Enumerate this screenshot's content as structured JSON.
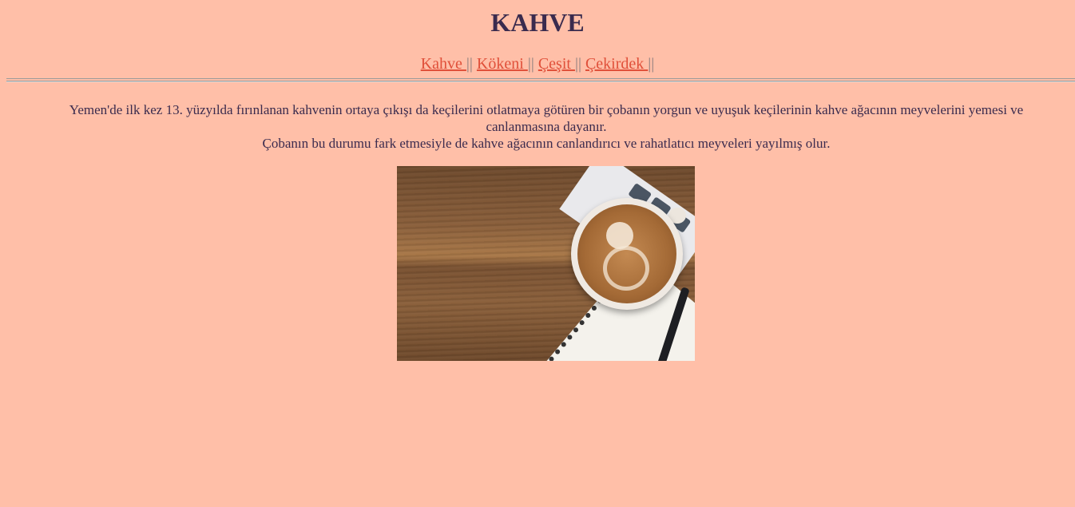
{
  "header": {
    "title": "KAHVE"
  },
  "nav": {
    "items": [
      {
        "label": "Kahve "
      },
      {
        "label": "Kökeni "
      },
      {
        "label": "Çeşit "
      },
      {
        "label": "Çekirdek "
      }
    ],
    "separator": "||"
  },
  "content": {
    "paragraph_line1": "Yemen'de ilk kez 13. yüzyılda fırınlanan kahvenin ortaya çıkışı da keçilerini otlatmaya götüren bir çobanın yorgun ve uyuşuk keçilerinin kahve ağacının meyvelerini yemesi ve canlanmasına dayanır.",
    "paragraph_line2": "Çobanın bu durumu fark etmesiyle de kahve ağacının canlandırıcı ve rahatlatıcı meyveleri yayılmış olur."
  },
  "colors": {
    "background": "#ffbfa8",
    "title": "#3a2b4e",
    "link": "#e0503a",
    "text": "#3a2b4e"
  }
}
